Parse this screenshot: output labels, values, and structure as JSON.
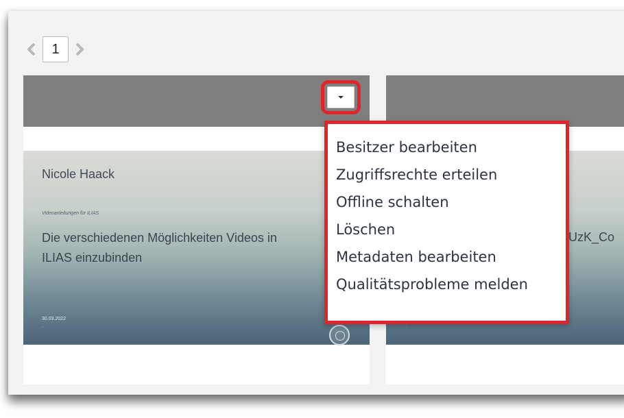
{
  "pagination": {
    "current_page": "1",
    "prev_icon": "chevron-left-icon",
    "next_icon": "chevron-right-icon"
  },
  "cards": [
    {
      "author": "Nicole Haack",
      "series": "Videoanleitungen für ILIAS",
      "title": "Die verschiedenen Möglichkeiten Videos in ILIAS einzubinden",
      "date": "30.03.2022",
      "dot": "·"
    },
    {
      "title_fragment": "r UzK_Co",
      "dot": "·"
    }
  ],
  "actions_menu": {
    "toggle_icon": "caret-down-icon",
    "items": [
      "Besitzer bearbeiten",
      "Zugriffsrechte erteilen",
      "Offline schalten",
      "Löschen",
      "Metadaten bearbeiten",
      "Qualitätsprobleme melden"
    ]
  },
  "colors": {
    "highlight": "#e0242b",
    "card_header": "#7f7f7f"
  }
}
